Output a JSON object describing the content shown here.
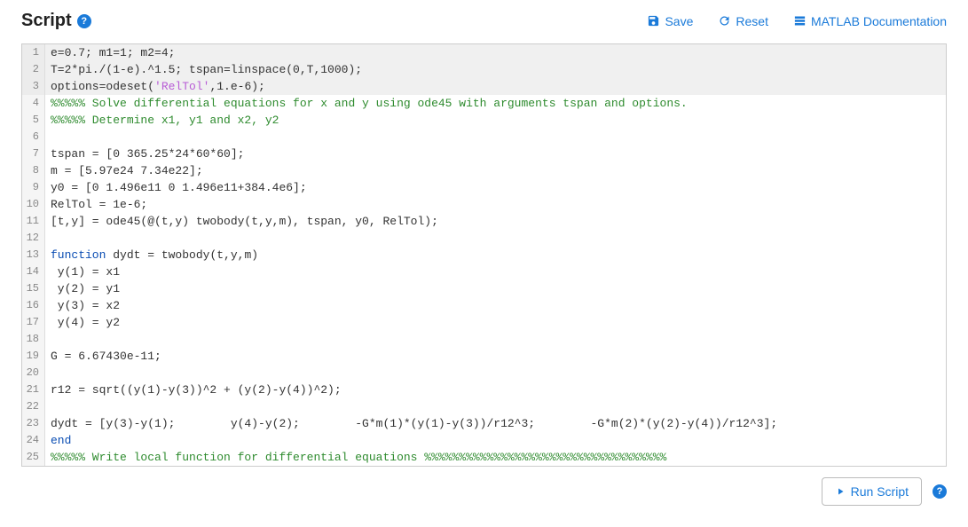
{
  "header": {
    "title": "Script",
    "save_label": "Save",
    "reset_label": "Reset",
    "docs_label": "MATLAB Documentation"
  },
  "code_lines": [
    {
      "n": 1,
      "locked": true,
      "tokens": [
        [
          "plain",
          "e=0.7; m1=1; m2=4;"
        ]
      ]
    },
    {
      "n": 2,
      "locked": true,
      "tokens": [
        [
          "plain",
          "T=2*pi./(1-e).^1.5; tspan=linspace(0,T,1000);"
        ]
      ]
    },
    {
      "n": 3,
      "locked": true,
      "tokens": [
        [
          "plain",
          "options=odeset("
        ],
        [
          "string",
          "'RelTol'"
        ],
        [
          "plain",
          ",1.e-6);"
        ]
      ]
    },
    {
      "n": 4,
      "locked": false,
      "tokens": [
        [
          "comment",
          "%%%%% Solve differential equations for x and y using ode45 with arguments tspan and options."
        ]
      ]
    },
    {
      "n": 5,
      "locked": false,
      "tokens": [
        [
          "comment",
          "%%%%% Determine x1, y1 and x2, y2"
        ]
      ]
    },
    {
      "n": 6,
      "locked": false,
      "tokens": [
        [
          "plain",
          ""
        ]
      ]
    },
    {
      "n": 7,
      "locked": false,
      "tokens": [
        [
          "plain",
          "tspan = [0 365.25*24*60*60];"
        ]
      ]
    },
    {
      "n": 8,
      "locked": false,
      "tokens": [
        [
          "plain",
          "m = [5.97e24 7.34e22];"
        ]
      ]
    },
    {
      "n": 9,
      "locked": false,
      "tokens": [
        [
          "plain",
          "y0 = [0 1.496e11 0 1.496e11+384.4e6];"
        ]
      ]
    },
    {
      "n": 10,
      "locked": false,
      "tokens": [
        [
          "plain",
          "RelTol = 1e-6;"
        ]
      ]
    },
    {
      "n": 11,
      "locked": false,
      "tokens": [
        [
          "plain",
          "[t,y] = ode45(@(t,y) twobody(t,y,m), tspan, y0, RelTol);"
        ]
      ]
    },
    {
      "n": 12,
      "locked": false,
      "tokens": [
        [
          "plain",
          ""
        ]
      ]
    },
    {
      "n": 13,
      "locked": false,
      "tokens": [
        [
          "keyword",
          "function"
        ],
        [
          "plain",
          " dydt = twobody(t,y,m)"
        ]
      ]
    },
    {
      "n": 14,
      "locked": false,
      "tokens": [
        [
          "plain",
          " y(1) = x1"
        ]
      ]
    },
    {
      "n": 15,
      "locked": false,
      "tokens": [
        [
          "plain",
          " y(2) = y1"
        ]
      ]
    },
    {
      "n": 16,
      "locked": false,
      "tokens": [
        [
          "plain",
          " y(3) = x2"
        ]
      ]
    },
    {
      "n": 17,
      "locked": false,
      "tokens": [
        [
          "plain",
          " y(4) = y2"
        ]
      ]
    },
    {
      "n": 18,
      "locked": false,
      "tokens": [
        [
          "plain",
          ""
        ]
      ]
    },
    {
      "n": 19,
      "locked": false,
      "tokens": [
        [
          "plain",
          "G = 6.67430e-11;"
        ]
      ]
    },
    {
      "n": 20,
      "locked": false,
      "tokens": [
        [
          "plain",
          ""
        ]
      ]
    },
    {
      "n": 21,
      "locked": false,
      "tokens": [
        [
          "plain",
          "r12 = sqrt((y(1)-y(3))^2 + (y(2)-y(4))^2);"
        ]
      ]
    },
    {
      "n": 22,
      "locked": false,
      "tokens": [
        [
          "plain",
          ""
        ]
      ]
    },
    {
      "n": 23,
      "locked": false,
      "tokens": [
        [
          "plain",
          "dydt = [y(3)-y(1);        y(4)-y(2);        -G*m(1)*(y(1)-y(3))/r12^3;        -G*m(2)*(y(2)-y(4))/r12^3];"
        ]
      ]
    },
    {
      "n": 24,
      "locked": false,
      "tokens": [
        [
          "keyword",
          "end"
        ]
      ]
    },
    {
      "n": 25,
      "locked": false,
      "tokens": [
        [
          "comment",
          "%%%%% Write local function for differential equations %%%%%%%%%%%%%%%%%%%%%%%%%%%%%%%%%%%"
        ]
      ]
    }
  ],
  "footer": {
    "run_label": "Run Script"
  }
}
